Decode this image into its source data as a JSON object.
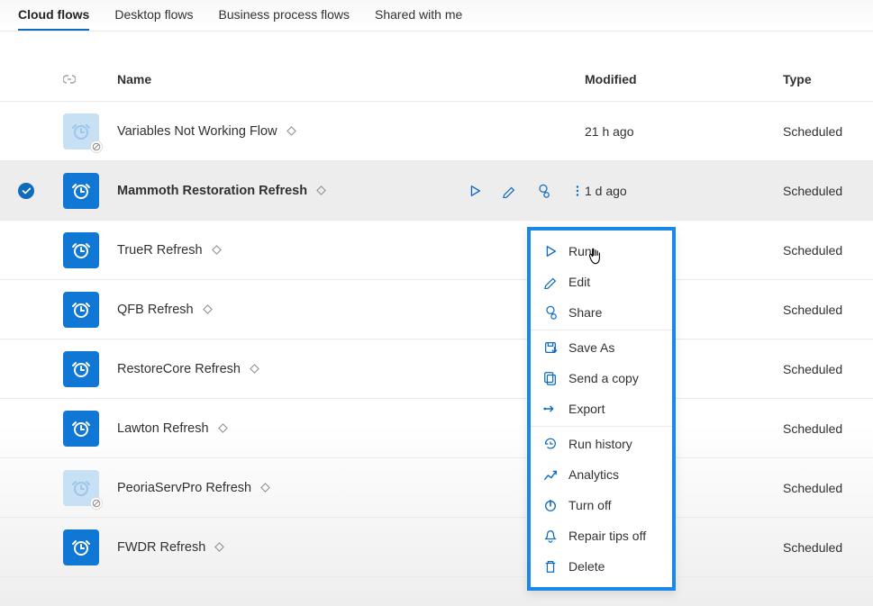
{
  "tabs": [
    {
      "label": "Cloud flows",
      "active": true
    },
    {
      "label": "Desktop flows",
      "active": false
    },
    {
      "label": "Business process flows",
      "active": false
    },
    {
      "label": "Shared with me",
      "active": false
    }
  ],
  "columns": {
    "name": "Name",
    "modified": "Modified",
    "type": "Type"
  },
  "flows": [
    {
      "name": "Variables Not Working Flow",
      "modified": "21 h ago",
      "type": "Scheduled",
      "enabled": false,
      "selected": false
    },
    {
      "name": "Mammoth Restoration Refresh",
      "modified": "1 d ago",
      "type": "Scheduled",
      "enabled": true,
      "selected": true
    },
    {
      "name": "TrueR Refresh",
      "modified": "",
      "type": "Scheduled",
      "enabled": true,
      "selected": false
    },
    {
      "name": "QFB Refresh",
      "modified": "",
      "type": "Scheduled",
      "enabled": true,
      "selected": false
    },
    {
      "name": "RestoreCore Refresh",
      "modified": "",
      "type": "Scheduled",
      "enabled": true,
      "selected": false
    },
    {
      "name": "Lawton Refresh",
      "modified": "",
      "type": "Scheduled",
      "enabled": true,
      "selected": false
    },
    {
      "name": "PeoriaServPro Refresh",
      "modified": "",
      "type": "Scheduled",
      "enabled": false,
      "selected": false
    },
    {
      "name": "FWDR Refresh",
      "modified": "",
      "type": "Scheduled",
      "enabled": true,
      "selected": false
    }
  ],
  "context_menu": {
    "groups": [
      [
        {
          "icon": "play",
          "label": "Run"
        },
        {
          "icon": "pencil",
          "label": "Edit"
        },
        {
          "icon": "share",
          "label": "Share"
        }
      ],
      [
        {
          "icon": "saveas",
          "label": "Save As"
        },
        {
          "icon": "copy",
          "label": "Send a copy"
        },
        {
          "icon": "export",
          "label": "Export"
        }
      ],
      [
        {
          "icon": "history",
          "label": "Run history"
        },
        {
          "icon": "analytics",
          "label": "Analytics"
        },
        {
          "icon": "power",
          "label": "Turn off"
        },
        {
          "icon": "bell",
          "label": "Repair tips off"
        },
        {
          "icon": "trash",
          "label": "Delete"
        }
      ]
    ]
  }
}
